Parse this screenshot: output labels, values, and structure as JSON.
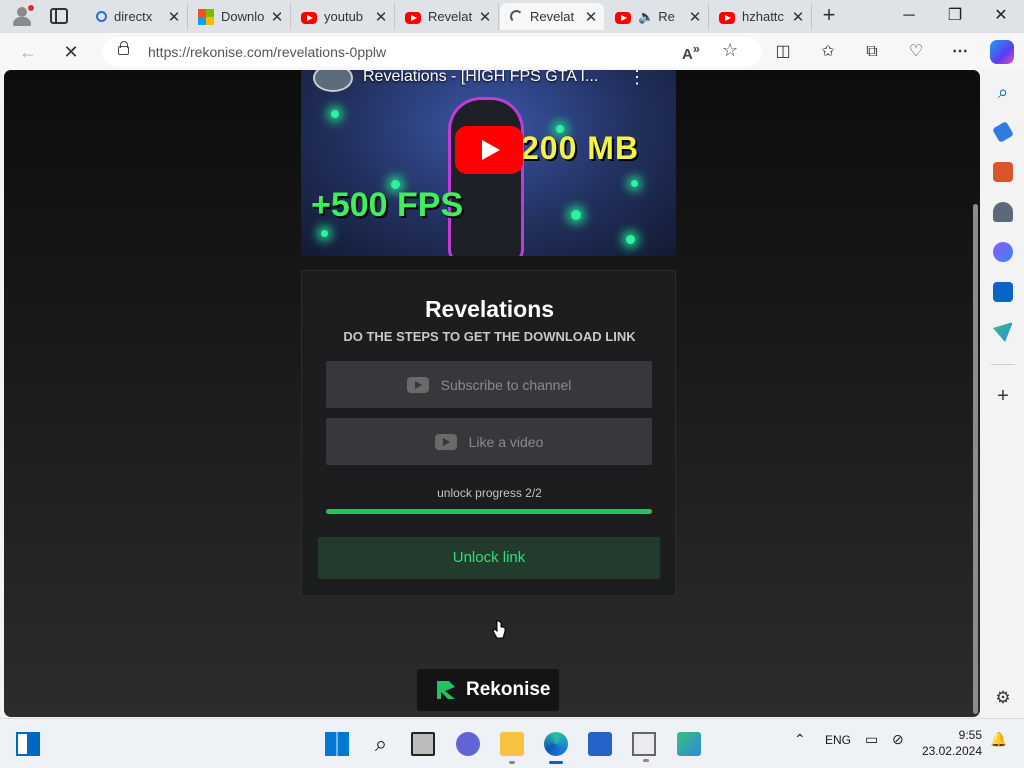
{
  "browser": {
    "tabs": [
      {
        "label": "directx",
        "favicon": "search-icon"
      },
      {
        "label": "Downlo",
        "favicon": "microsoft-icon"
      },
      {
        "label": "youtub",
        "favicon": "youtube-icon"
      },
      {
        "label": "Revelat",
        "favicon": "youtube-icon"
      },
      {
        "label": "Revelat",
        "favicon": "loading-icon",
        "active": true
      },
      {
        "label": "Re",
        "favicon": "youtube-icon",
        "audio": "speaker-icon"
      },
      {
        "label": "hzhattc",
        "favicon": "youtube-icon"
      }
    ],
    "close_glyph": "✕",
    "new_tab_glyph": "+",
    "url": "https://rekonise.com/revelations-0pplw",
    "window_controls": {
      "minimize": "─",
      "maximize": "❐",
      "close": "✕"
    }
  },
  "video": {
    "title": "Revelations - [HIGH FPS GTA I...",
    "overlay_size": "200 MB",
    "overlay_fps": "+500 FPS",
    "menu_glyph": "⋮"
  },
  "card": {
    "title": "Revelations",
    "subtitle": "DO THE STEPS TO GET THE DOWNLOAD LINK",
    "steps": [
      {
        "label": "Subscribe to channel",
        "icon": "youtube-icon"
      },
      {
        "label": "Like a video",
        "icon": "youtube-icon"
      }
    ],
    "progress_label": "unlock progress 2/2",
    "progress_fraction": 1.0,
    "unlock_label": "Unlock link"
  },
  "brand": {
    "name": "Rekonise"
  },
  "colors": {
    "accent": "#21c461",
    "unlock_text": "#2ee07a",
    "page_bg": "#1c1d1f"
  },
  "taskbar": {
    "language": "ENG",
    "time": "9:55",
    "date": "23.02.2024"
  }
}
